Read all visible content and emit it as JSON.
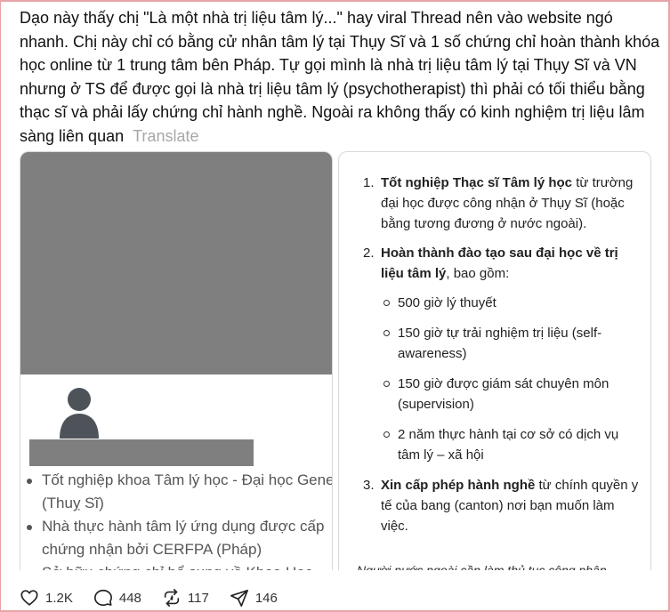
{
  "post": {
    "text": "Dạo này thấy chị \"Là một nhà trị liệu tâm lý...\" hay viral Thread nên vào website ngó nhanh. Chị này chỉ có bằng cử nhân tâm lý tại Thụy Sĩ và 1 số chứng chỉ hoàn thành khóa học online từ 1 trung tâm bên Pháp. Tự gọi mình là nhà trị liệu tâm lý tại Thụy Sĩ và VN nhưng ở TS để được gọi là nhà trị liệu tâm lý (psychotherapist) thì phải có tối thiểu bằng thạc sĩ và phải lấy chứng chỉ hành nghề. Ngoài ra không thấy có kinh nghiệm trị liệu lâm sàng liên quan",
    "translate_label": "Translate"
  },
  "left_card": {
    "items": [
      "Tốt nghiệp khoa Tâm lý học - Đại học Geneva (Thuỵ Sĩ)",
      "Nhà thực hành tâm lý ứng dụng được cấp chứng nhận bởi CERFPA (Pháp)",
      "Sở hữu chứng chỉ bổ sung về Khoa Học"
    ]
  },
  "right_card": {
    "items": [
      {
        "num": "1.",
        "bold": "Tốt nghiệp Thạc sĩ Tâm lý học",
        "rest": " từ trường đại học được công nhận ở Thụy Sĩ (hoặc bằng tương đương ở nước ngoài)."
      },
      {
        "num": "2.",
        "bold": "Hoàn thành đào tạo sau đại học về trị liệu tâm lý",
        "rest": ", bao gồm:",
        "sub": [
          "500 giờ lý thuyết",
          "150 giờ tự trải nghiệm trị liệu (self-awareness)",
          "150 giờ được giám sát chuyên môn (supervision)",
          "2 năm thực hành tại cơ sở có dịch vụ tâm lý – xã hội"
        ]
      },
      {
        "num": "3.",
        "bold": "Xin cấp phép hành nghề",
        "rest": " từ chính quyền y tế của bang (canton) nơi bạn muốn làm việc."
      }
    ],
    "footnote": "Người nước ngoài cần làm thủ tục công nhận"
  },
  "actions": {
    "like": "1.2K",
    "comment": "448",
    "repost": "117",
    "share": "146"
  }
}
